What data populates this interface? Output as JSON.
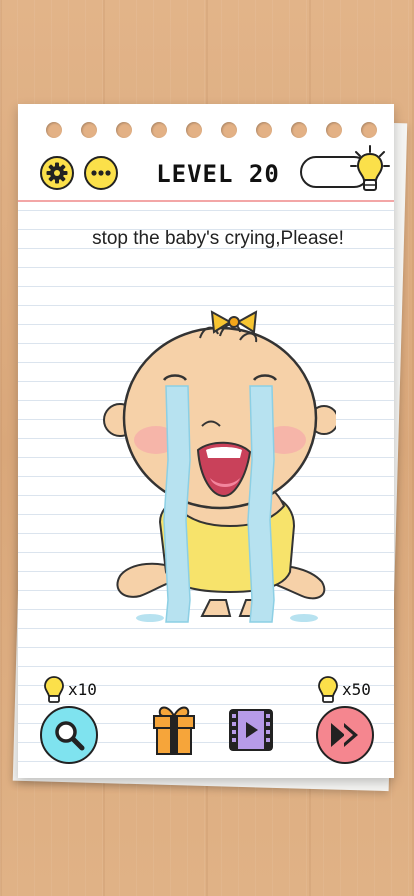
{
  "header": {
    "level_text": "LEVEL 20",
    "settings_icon": "gear-icon",
    "more_icon": "more-dots-icon",
    "toggle_icon": "lightbulb-icon"
  },
  "puzzle": {
    "prompt": "stop the baby's crying,Please!"
  },
  "footer": {
    "hint_cost": "x10",
    "skip_cost": "x50",
    "hint_icon": "magnifier-icon",
    "gift_icon": "gift-icon",
    "video_icon": "video-icon",
    "skip_icon": "fast-forward-icon"
  },
  "colors": {
    "button_yellow": "#fbe04a",
    "hint_button": "#7fe3ef",
    "skip_button": "#f5868f",
    "margin_line": "#f3a6a6"
  }
}
